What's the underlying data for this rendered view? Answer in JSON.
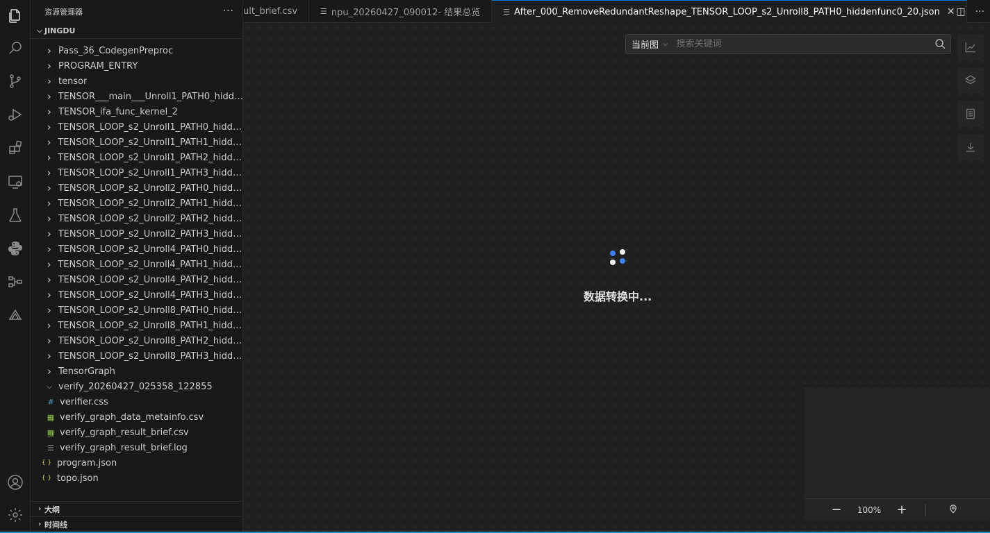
{
  "activity_bar": {
    "items": [
      "explorer-icon",
      "search-icon",
      "source-control-icon",
      "run-debug-icon",
      "extensions-icon",
      "remote-explorer-icon",
      "testing-icon",
      "python-icon",
      "graph-flow-icon",
      "cloud-icon"
    ],
    "bottom": [
      "account-icon",
      "settings-gear-icon"
    ]
  },
  "sidebar": {
    "title": "资源管理器",
    "more": "···",
    "workspace": "JINGDU",
    "items": [
      {
        "label": "Pass_36_CodegenPreproc",
        "type": "folder"
      },
      {
        "label": "PROGRAM_ENTRY",
        "type": "folder"
      },
      {
        "label": "tensor",
        "type": "folder"
      },
      {
        "label": "TENSOR___main___Unroll1_PATH0_hidde...",
        "type": "folder"
      },
      {
        "label": "TENSOR_ifa_func_kernel_2",
        "type": "folder"
      },
      {
        "label": "TENSOR_LOOP_s2_Unroll1_PATH0_hidden...",
        "type": "folder"
      },
      {
        "label": "TENSOR_LOOP_s2_Unroll1_PATH1_hidden...",
        "type": "folder"
      },
      {
        "label": "TENSOR_LOOP_s2_Unroll1_PATH2_hidden...",
        "type": "folder"
      },
      {
        "label": "TENSOR_LOOP_s2_Unroll1_PATH3_hidden...",
        "type": "folder"
      },
      {
        "label": "TENSOR_LOOP_s2_Unroll2_PATH0_hidde...",
        "type": "folder"
      },
      {
        "label": "TENSOR_LOOP_s2_Unroll2_PATH1_hidden...",
        "type": "folder"
      },
      {
        "label": "TENSOR_LOOP_s2_Unroll2_PATH2_hidde...",
        "type": "folder"
      },
      {
        "label": "TENSOR_LOOP_s2_Unroll2_PATH3_hidde...",
        "type": "folder"
      },
      {
        "label": "TENSOR_LOOP_s2_Unroll4_PATH0_hidde...",
        "type": "folder"
      },
      {
        "label": "TENSOR_LOOP_s2_Unroll4_PATH1_hidden...",
        "type": "folder"
      },
      {
        "label": "TENSOR_LOOP_s2_Unroll4_PATH2_hidde...",
        "type": "folder"
      },
      {
        "label": "TENSOR_LOOP_s2_Unroll4_PATH3_hidde...",
        "type": "folder"
      },
      {
        "label": "TENSOR_LOOP_s2_Unroll8_PATH0_hidde...",
        "type": "folder"
      },
      {
        "label": "TENSOR_LOOP_s2_Unroll8_PATH1_hidden...",
        "type": "folder"
      },
      {
        "label": "TENSOR_LOOP_s2_Unroll8_PATH2_hidde...",
        "type": "folder"
      },
      {
        "label": "TENSOR_LOOP_s2_Unroll8_PATH3_hidde...",
        "type": "folder"
      },
      {
        "label": "TensorGraph",
        "type": "folder"
      },
      {
        "label": "verify_20260427_025358_122855",
        "type": "folder-open"
      },
      {
        "label": "verifier.css",
        "type": "css"
      },
      {
        "label": "verify_graph_data_metainfo.csv",
        "type": "csv"
      },
      {
        "label": "verify_graph_result_brief.csv",
        "type": "csv"
      },
      {
        "label": "verify_graph_result_brief.log",
        "type": "log"
      },
      {
        "label": "program.json",
        "type": "json"
      },
      {
        "label": "topo.json",
        "type": "json"
      }
    ],
    "outline": "大纲",
    "timeline": "时间线"
  },
  "tabs": [
    {
      "label": "ult_brief.csv",
      "active": false
    },
    {
      "label": "npu_20260427_090012- 结果总览",
      "active": false
    },
    {
      "label": "After_000_RemoveRedundantReshape_TENSOR_LOOP_s2_Unroll8_PATH0_hiddenfunc0_20.json",
      "active": true
    }
  ],
  "toolbar": {
    "scope_label": "当前图",
    "search_placeholder": "搜索关键词"
  },
  "right_tools": [
    "chart-icon",
    "layers-icon",
    "document-icon",
    "download-icon"
  ],
  "loading": {
    "text": "数据转换中..."
  },
  "zoom": {
    "minus": "−",
    "level": "100%",
    "plus": "+"
  },
  "colors": {
    "accent": "#0078d4",
    "spinner_blue": "#3b82f6",
    "spinner_white": "#f0f0f0",
    "status_line": "#2a8cbf"
  }
}
